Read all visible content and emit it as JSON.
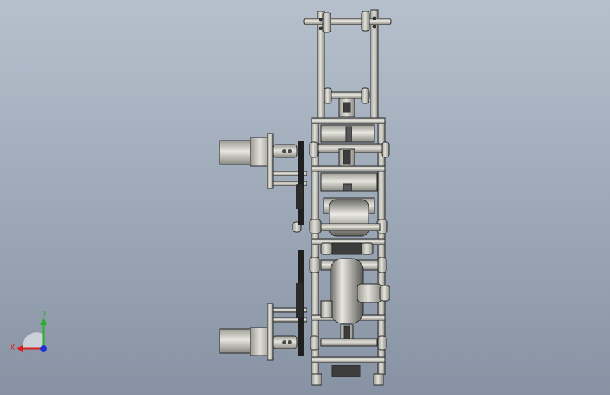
{
  "viewport": {
    "background_top": "#b9c3d0",
    "background_bottom": "#8995a6"
  },
  "model": {
    "steel_color": "#c9c8c0",
    "dark_color": "#3c3c3c",
    "edge_color": "#2a2a2a"
  },
  "triad": {
    "x_label": "X",
    "y_label": "Y",
    "x_color": "#d32020",
    "y_color": "#2bb02b",
    "z_color": "#2030d0"
  }
}
